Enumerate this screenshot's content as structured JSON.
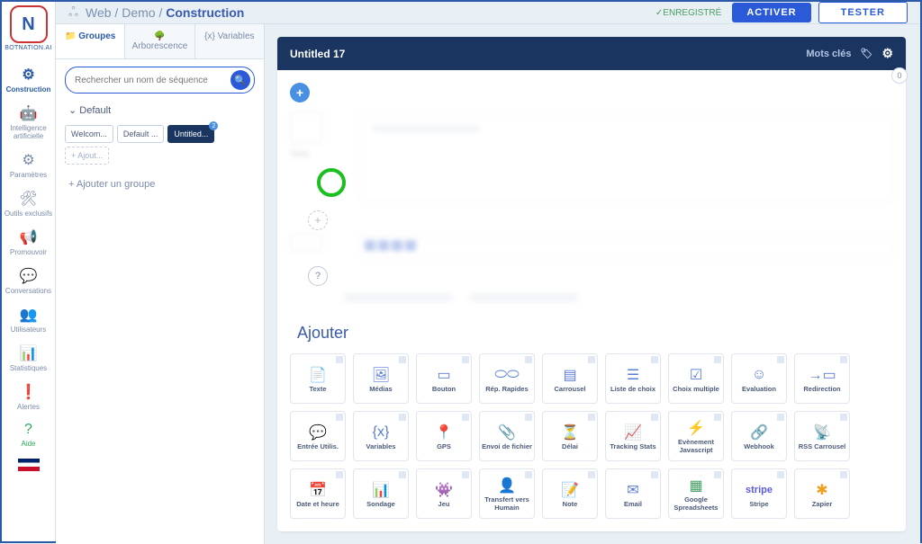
{
  "brand": "BOTNATION.AI",
  "breadcrumb": {
    "part1": "Web",
    "part2": "Demo",
    "part3": "Construction"
  },
  "saved_label": "ENREGISTRÉ",
  "btn_activate": "ACTIVER",
  "btn_test": "TESTER",
  "rail": [
    {
      "label": "Construction",
      "icon": "⚙"
    },
    {
      "label": "Intelligence artificielle",
      "icon": "🤖"
    },
    {
      "label": "Paramètres",
      "icon": "⚙"
    },
    {
      "label": "Outils exclusifs",
      "icon": "🛠"
    },
    {
      "label": "Promouvoir",
      "icon": "📢"
    },
    {
      "label": "Conversations",
      "icon": "💬"
    },
    {
      "label": "Utilisateurs",
      "icon": "👥"
    },
    {
      "label": "Statistiques",
      "icon": "📊"
    },
    {
      "label": "Alertes",
      "icon": "❗"
    },
    {
      "label": "Aide",
      "icon": "?"
    }
  ],
  "tabs": {
    "groupes": "Groupes",
    "arborescence": "Arborescence",
    "variables": "Variables"
  },
  "search_placeholder": "Rechercher un nom de séquence",
  "group_default": "Default",
  "chips": {
    "welcome": "Welcom...",
    "default": "Default ...",
    "untitled": "Untitled...",
    "ajout": "Ajout..."
  },
  "add_group": "Ajouter un groupe",
  "card_title": "Untitled 17",
  "mots_cles": "Mots clés",
  "ajouter_title": "Ajouter",
  "notif_count": "0",
  "tiles": [
    {
      "label": "Texte",
      "icon": "📄"
    },
    {
      "label": "Médias",
      "icon": "🖼"
    },
    {
      "label": "Bouton",
      "icon": "▭"
    },
    {
      "label": "Rép. Rapides",
      "icon": "⬭⬭"
    },
    {
      "label": "Carrousel",
      "icon": "▤"
    },
    {
      "label": "Liste de choix",
      "icon": "☰"
    },
    {
      "label": "Choix multiple",
      "icon": "☑"
    },
    {
      "label": "Evaluation",
      "icon": "☺"
    },
    {
      "label": "Redirection",
      "icon": "→▭"
    },
    {
      "label": "Entrée Utilis.",
      "icon": "💬"
    },
    {
      "label": "Variables",
      "icon": "{x}"
    },
    {
      "label": "GPS",
      "icon": "📍"
    },
    {
      "label": "Envoi de fichier",
      "icon": "📎"
    },
    {
      "label": "Délai",
      "icon": "⏳"
    },
    {
      "label": "Tracking Stats",
      "icon": "📈"
    },
    {
      "label": "Evènement Javascript",
      "icon": "⚡"
    },
    {
      "label": "Webhook",
      "icon": "🔗",
      "cls": "icon-red"
    },
    {
      "label": "RSS Carrousel",
      "icon": "📡",
      "cls": "icon-orange"
    },
    {
      "label": "Date et heure",
      "icon": "📅",
      "cls": "icon-red"
    },
    {
      "label": "Sondage",
      "icon": "📊"
    },
    {
      "label": "Jeu",
      "icon": "👾",
      "cls": "icon-purple"
    },
    {
      "label": "Transfert vers Humain",
      "icon": "👤"
    },
    {
      "label": "Note",
      "icon": "📝"
    },
    {
      "label": "Email",
      "icon": "✉"
    },
    {
      "label": "Google Spreadsheets",
      "icon": "▦",
      "cls": "icon-green"
    },
    {
      "label": "Stripe",
      "icon": "stripe",
      "text": true
    },
    {
      "label": "Zapier",
      "icon": "✱",
      "cls": "icon-orange"
    }
  ]
}
